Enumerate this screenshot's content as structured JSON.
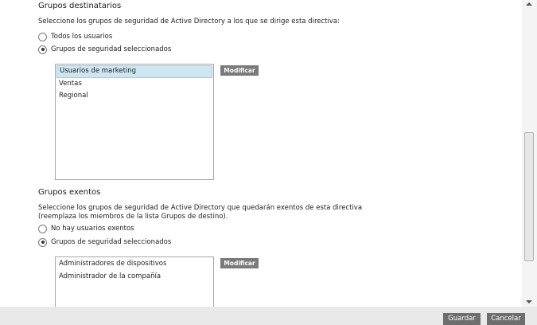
{
  "target_groups": {
    "title": "Grupos destinatarios",
    "description": "Seleccione los grupos de seguridad de Active Directory a los que se dirige esta directiva:",
    "radio_all": "Todos los usuarios",
    "radio_selected": "Grupos de seguridad seleccionados",
    "selected_option": "radio_selected",
    "items": [
      "Usuarios de marketing",
      "Ventas",
      "Regional"
    ],
    "selected_item_index": 0,
    "modify_label": "Modificar"
  },
  "exempt_groups": {
    "title": "Grupos exentos",
    "description_line1": "Seleccione los grupos de seguridad de Active Directory que quedarán exentos de esta directiva",
    "description_line2": "(reemplaza los miembros de la lista Grupos de destino).",
    "radio_none": "No hay usuarios exentos",
    "radio_selected": "Grupos de seguridad seleccionados",
    "selected_option": "radio_selected",
    "items": [
      "Administradores de dispositivos",
      "Administrador de la compañía"
    ],
    "modify_label": "Modificar"
  },
  "footer": {
    "save_label": "Guardar",
    "cancel_label": "Cancelar"
  },
  "colors": {
    "button_bg": "#7a7a7a",
    "selected_item_bg": "#cde6f1",
    "footer_bg": "#e9e9e9"
  }
}
